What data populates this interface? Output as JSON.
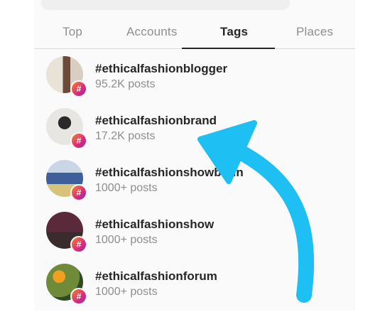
{
  "tabs": [
    {
      "label": "Top",
      "active": false
    },
    {
      "label": "Accounts",
      "active": false
    },
    {
      "label": "Tags",
      "active": true
    },
    {
      "label": "Places",
      "active": false
    }
  ],
  "results": [
    {
      "tag": "#ethicalfashionblogger",
      "posts": "95.2K posts"
    },
    {
      "tag": "#ethicalfashionbrand",
      "posts": "17.2K posts"
    },
    {
      "tag": "#ethicalfashionshowbrain",
      "posts": "1000+ posts"
    },
    {
      "tag": "#ethicalfashionshow",
      "posts": "1000+ posts"
    },
    {
      "tag": "#ethicalfashionforum",
      "posts": "1000+ posts"
    }
  ],
  "badge_symbol": "#",
  "colors": {
    "annotation_arrow": "#1ec0f4",
    "badge_gradient": [
      "#f58529",
      "#dd2a7b",
      "#8134af"
    ]
  }
}
